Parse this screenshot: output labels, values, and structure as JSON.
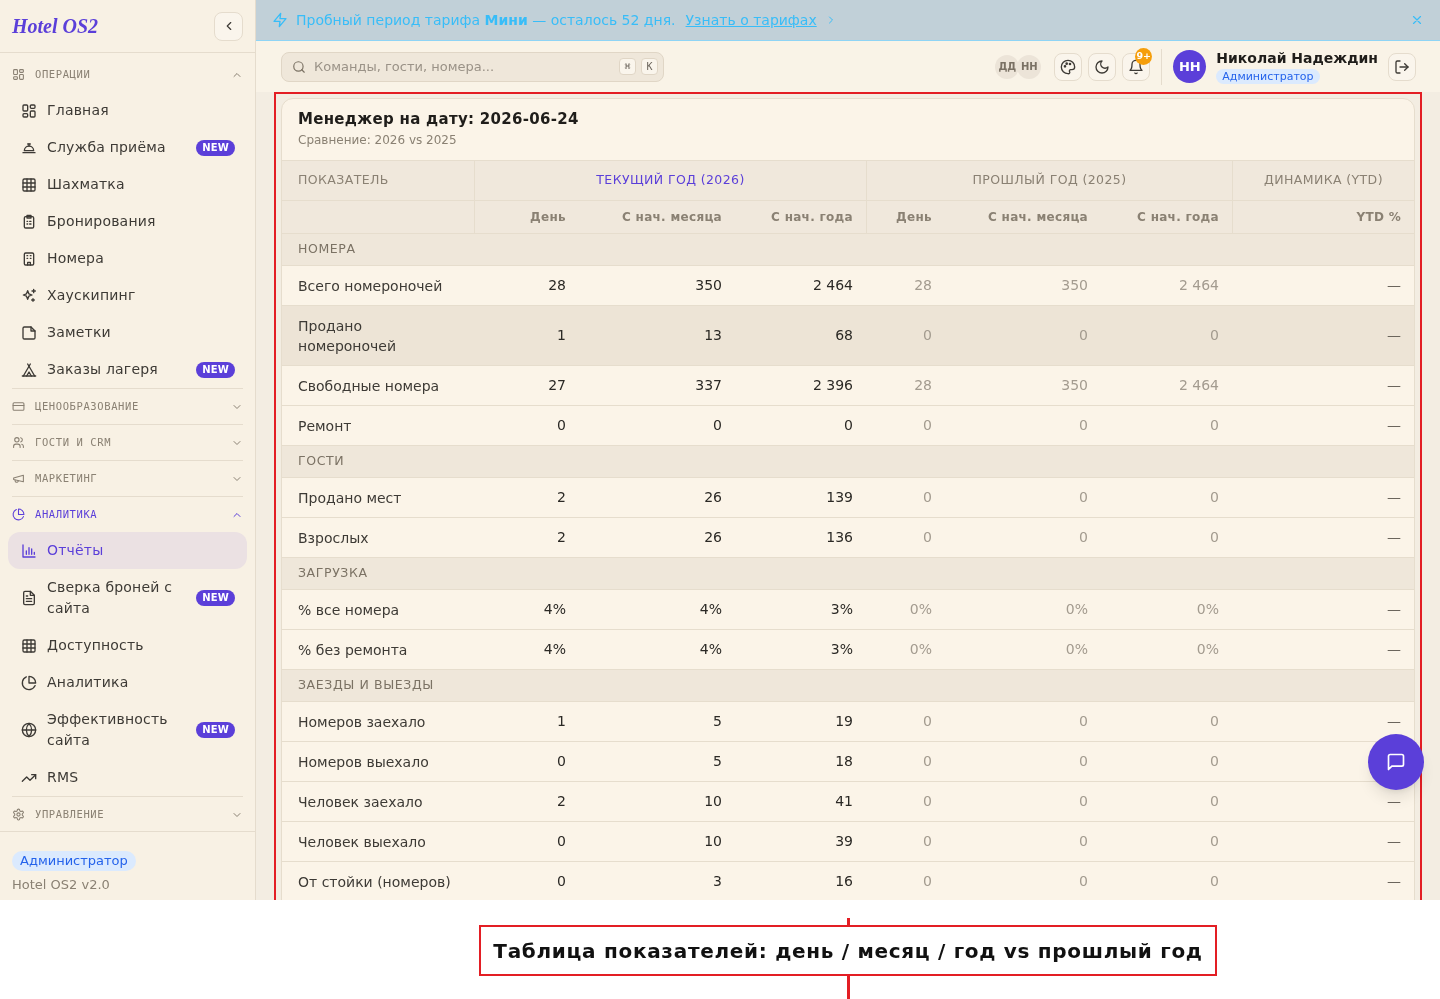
{
  "sidebar": {
    "logo": "Hotel OS2",
    "sections": [
      {
        "title": "ОПЕРАЦИИ",
        "expanded": true,
        "items": [
          {
            "label": "Главная",
            "selected": false
          },
          {
            "label": "Служба приёма",
            "selected": false,
            "badge": "NEW"
          },
          {
            "label": "Шахматка",
            "selected": false
          },
          {
            "label": "Бронирования",
            "selected": false
          },
          {
            "label": "Номера",
            "selected": false
          },
          {
            "label": "Хаускипинг",
            "selected": false
          },
          {
            "label": "Заметки",
            "selected": false
          },
          {
            "label": "Заказы лагеря",
            "selected": false,
            "badge": "NEW"
          }
        ]
      },
      {
        "title": "ЦЕНООБРАЗОВАНИЕ",
        "expanded": false
      },
      {
        "title": "ГОСТИ И CRM",
        "expanded": false
      },
      {
        "title": "МАРКЕТИНГ",
        "expanded": false
      },
      {
        "title": "АНАЛИТИКА",
        "expanded": true,
        "items": [
          {
            "label": "Отчёты",
            "selected": true
          },
          {
            "label": "Сверка броней с сайта",
            "selected": false,
            "badge": "NEW"
          },
          {
            "label": "Доступность",
            "selected": false
          },
          {
            "label": "Аналитика",
            "selected": false
          },
          {
            "label": "Эффективность сайта",
            "selected": false,
            "badge": "NEW"
          },
          {
            "label": "RMS",
            "selected": false
          }
        ]
      },
      {
        "title": "УПРАВЛЕНИЕ",
        "expanded": false
      }
    ],
    "footer": {
      "role": "Администратор",
      "version": "Hotel OS2 v2.0"
    }
  },
  "banner": {
    "message": "Пробный период тарифа **Мини** — осталось 52 дня.",
    "link": "Узнать о тарифах"
  },
  "topbar": {
    "search": {
      "placeholder": "Команды, гости, номера...",
      "shortcut": [
        "⌘",
        "K"
      ]
    },
    "online_users": [
      "ДД",
      "НН"
    ],
    "notification_count": "9+",
    "user": {
      "initials": "НН",
      "name": "Николай Надеждин",
      "role": "Администратор"
    }
  },
  "report": {
    "title": "Менеджер на дату: 2026-06-24",
    "subtitle": "Сравнение: 2026 vs 2025",
    "table": {
      "first_column": "ПОКАЗАТЕЛЬ",
      "groups": [
        {
          "label": "ТЕКУЩИЙ ГОД (2026)",
          "kind": "current",
          "columns": [
            "День",
            "С нач. месяца",
            "С нач. года"
          ]
        },
        {
          "label": "ПРОШЛЫЙ ГОД (2025)",
          "kind": "previous",
          "columns": [
            "День",
            "С нач. месяца",
            "С нач. года"
          ]
        },
        {
          "label": "ДИНАМИКА (YTD)",
          "kind": "change",
          "columns": [
            "YTD %"
          ]
        }
      ],
      "sections": [
        {
          "title": "НОМЕРА",
          "rows": [
            {
              "label": "Всего номероночей",
              "highlighted": false,
              "current": [
                "28",
                "350",
                "2 464"
              ],
              "previous": [
                "28",
                "350",
                "2 464"
              ],
              "change": "—"
            },
            {
              "label": "Продано номероночей",
              "highlighted": true,
              "current": [
                "1",
                "13",
                "68"
              ],
              "previous": [
                "0",
                "0",
                "0"
              ],
              "change": "—"
            },
            {
              "label": "Свободные номера",
              "highlighted": false,
              "current": [
                "27",
                "337",
                "2 396"
              ],
              "previous": [
                "28",
                "350",
                "2 464"
              ],
              "change": "—"
            },
            {
              "label": "Ремонт",
              "highlighted": false,
              "current": [
                "0",
                "0",
                "0"
              ],
              "previous": [
                "0",
                "0",
                "0"
              ],
              "change": "—"
            }
          ]
        },
        {
          "title": "ГОСТИ",
          "rows": [
            {
              "label": "Продано мест",
              "highlighted": false,
              "current": [
                "2",
                "26",
                "139"
              ],
              "previous": [
                "0",
                "0",
                "0"
              ],
              "change": "—"
            },
            {
              "label": "Взрослых",
              "highlighted": false,
              "current": [
                "2",
                "26",
                "136"
              ],
              "previous": [
                "0",
                "0",
                "0"
              ],
              "change": "—"
            }
          ]
        },
        {
          "title": "ЗАГРУЗКА",
          "rows": [
            {
              "label": "% все номера",
              "highlighted": false,
              "current": [
                "4%",
                "4%",
                "3%"
              ],
              "previous": [
                "0%",
                "0%",
                "0%"
              ],
              "change": "—"
            },
            {
              "label": "% без ремонта",
              "highlighted": false,
              "current": [
                "4%",
                "4%",
                "3%"
              ],
              "previous": [
                "0%",
                "0%",
                "0%"
              ],
              "change": "—"
            }
          ]
        },
        {
          "title": "ЗАЕЗДЫ И ВЫЕЗДЫ",
          "rows": [
            {
              "label": "Номеров заехало",
              "highlighted": false,
              "current": [
                "1",
                "5",
                "19"
              ],
              "previous": [
                "0",
                "0",
                "0"
              ],
              "change": "—"
            },
            {
              "label": "Номеров выехало",
              "highlighted": false,
              "current": [
                "0",
                "5",
                "18"
              ],
              "previous": [
                "0",
                "0",
                "0"
              ]
            },
            {
              "label": "Человек заехало",
              "highlighted": false,
              "current": [
                "2",
                "10",
                "41"
              ],
              "previous": [
                "0",
                "0",
                "0"
              ],
              "change": "—"
            },
            {
              "label": "Человек выехало",
              "highlighted": false,
              "current": [
                "0",
                "10",
                "39"
              ],
              "previous": [
                "0",
                "0",
                "0"
              ],
              "change": "—"
            },
            {
              "label": "От стойки (номеров)",
              "highlighted": false,
              "current": [
                "0",
                "3",
                "16"
              ],
              "previous": [
                "0",
                "0",
                "0"
              ],
              "change": "—"
            }
          ]
        }
      ]
    }
  },
  "annotation": {
    "caption": "Таблица показателей: день / месяц / год vs прошлый год"
  }
}
